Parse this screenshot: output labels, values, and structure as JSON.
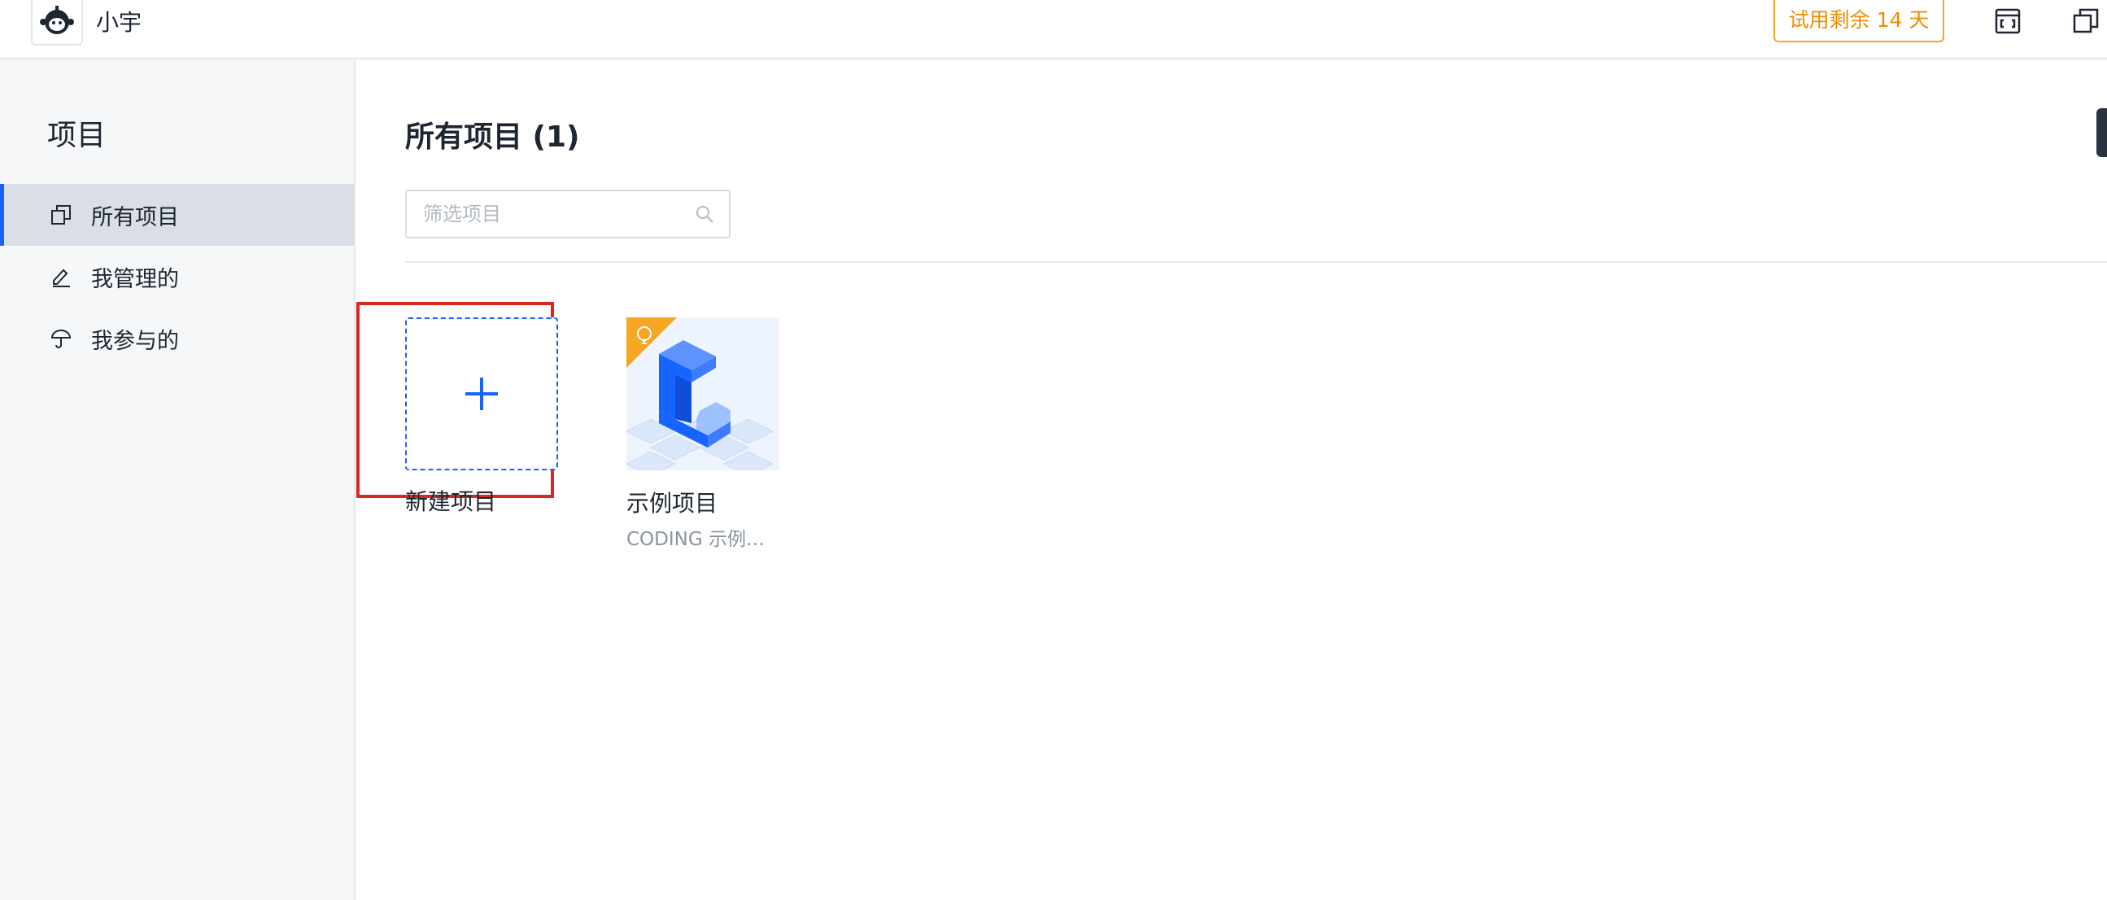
{
  "header": {
    "team_name": "小宇",
    "trial_label": "试用剩余 14 天",
    "icons": [
      "robot-avatar-icon",
      "frame-icon",
      "window-icon"
    ]
  },
  "sidebar": {
    "title": "项目",
    "items": [
      {
        "label": "所有项目",
        "icon": "copy-icon",
        "active": true
      },
      {
        "label": "我管理的",
        "icon": "pencil-icon",
        "active": false
      },
      {
        "label": "我参与的",
        "icon": "umbrella-icon",
        "active": false
      }
    ]
  },
  "main": {
    "title": "所有项目 (1)",
    "search_placeholder": "筛选项目",
    "new_project_label": "新建项目",
    "projects": [
      {
        "name": "示例项目",
        "description": "CODING 示例…"
      }
    ]
  },
  "colors": {
    "accent": "#1664ff",
    "trial": "#f08c00",
    "highlight": "#d6291f"
  }
}
